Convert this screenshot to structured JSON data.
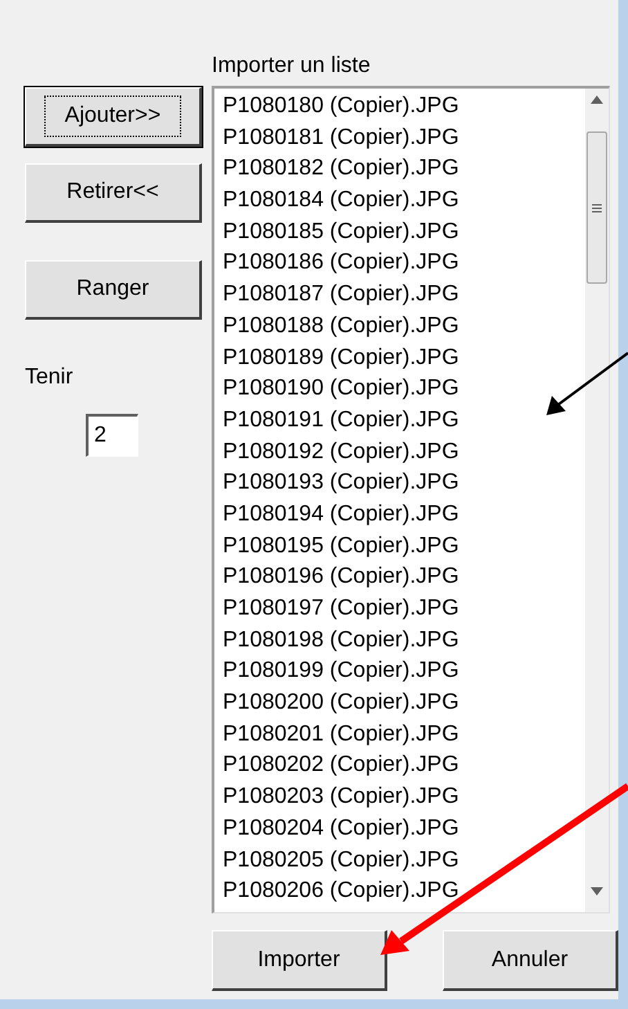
{
  "buttons": [
    {
      "label": "Ajouter>>",
      "default": true
    },
    {
      "label": "Retirer<<",
      "default": false
    },
    {
      "label": "Ranger",
      "default": false
    }
  ],
  "hold": {
    "label": "Tenir",
    "value": "2"
  },
  "list": {
    "title": "Importer un liste",
    "items": [
      "P1080180 (Copier).JPG",
      "P1080181 (Copier).JPG",
      "P1080182 (Copier).JPG",
      "P1080184 (Copier).JPG",
      "P1080185 (Copier).JPG",
      "P1080186 (Copier).JPG",
      "P1080187 (Copier).JPG",
      "P1080188 (Copier).JPG",
      "P1080189 (Copier).JPG",
      "P1080190 (Copier).JPG",
      "P1080191 (Copier).JPG",
      "P1080192 (Copier).JPG",
      "P1080193 (Copier).JPG",
      "P1080194 (Copier).JPG",
      "P1080195 (Copier).JPG",
      "P1080196 (Copier).JPG",
      "P1080197 (Copier).JPG",
      "P1080198 (Copier).JPG",
      "P1080199 (Copier).JPG",
      "P1080200 (Copier).JPG",
      "P1080201 (Copier).JPG",
      "P1080202 (Copier).JPG",
      "P1080203 (Copier).JPG",
      "P1080204 (Copier).JPG",
      "P1080205 (Copier).JPG",
      "P1080206 (Copier).JPG"
    ]
  },
  "footer_buttons": [
    "Importer",
    "Annuler"
  ],
  "annotations": [
    {
      "kind": "arrow",
      "color": "#000000"
    },
    {
      "kind": "arrow",
      "color": "#ff0000"
    }
  ]
}
